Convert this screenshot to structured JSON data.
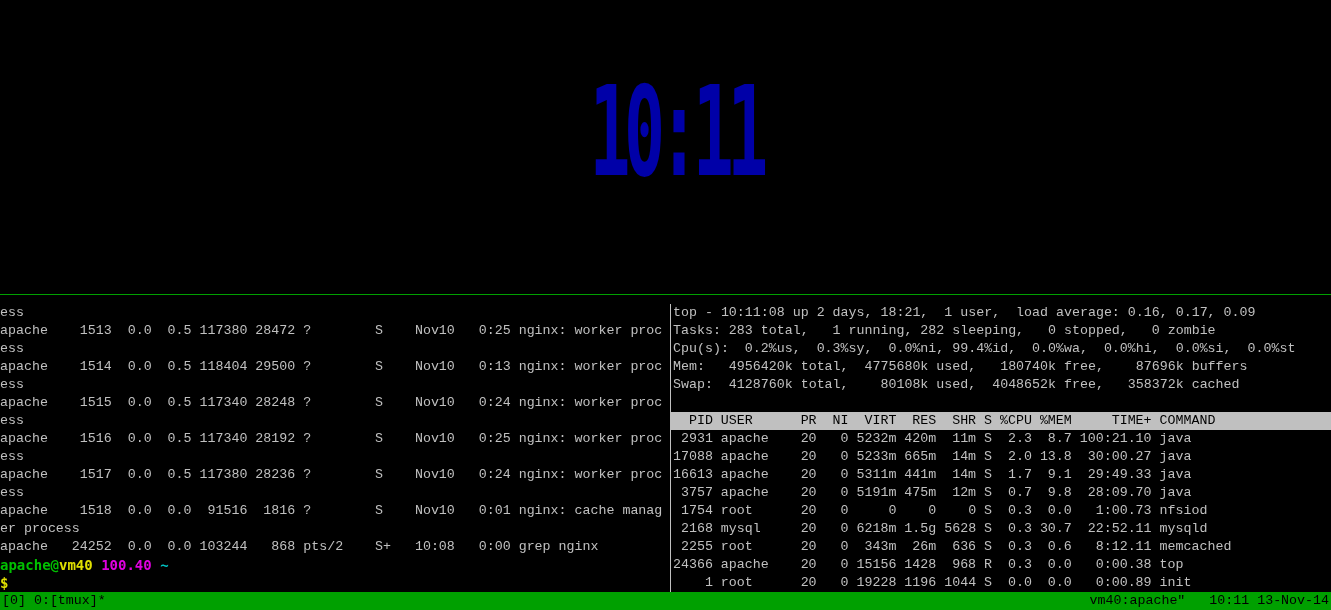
{
  "clock_pane": {
    "time": "10:11"
  },
  "left_pane": {
    "lines": [
      {
        "kind": "text",
        "text": "ess"
      },
      {
        "kind": "text",
        "text": "apache    1513  0.0  0.5 117380 28472 ?        S    Nov10   0:25 nginx: worker proc"
      },
      {
        "kind": "text",
        "text": "ess"
      },
      {
        "kind": "text",
        "text": "apache    1514  0.0  0.5 118404 29500 ?        S    Nov10   0:13 nginx: worker proc"
      },
      {
        "kind": "text",
        "text": "ess"
      },
      {
        "kind": "text",
        "text": "apache    1515  0.0  0.5 117340 28248 ?        S    Nov10   0:24 nginx: worker proc"
      },
      {
        "kind": "text",
        "text": "ess"
      },
      {
        "kind": "text",
        "text": "apache    1516  0.0  0.5 117340 28192 ?        S    Nov10   0:25 nginx: worker proc"
      },
      {
        "kind": "text",
        "text": "ess"
      },
      {
        "kind": "text",
        "text": "apache    1517  0.0  0.5 117380 28236 ?        S    Nov10   0:24 nginx: worker proc"
      },
      {
        "kind": "text",
        "text": "ess"
      },
      {
        "kind": "text",
        "text": "apache    1518  0.0  0.0  91516  1816 ?        S    Nov10   0:01 nginx: cache manag"
      },
      {
        "kind": "text",
        "text": "er process"
      },
      {
        "kind": "text",
        "text": "apache   24252  0.0  0.0 103244   868 pts/2    S+   10:08   0:00 grep nginx"
      },
      {
        "kind": "prompt",
        "segments": [
          {
            "text": "apache@",
            "color": "#00c000"
          },
          {
            "text": "vm40",
            "color": "#e0e000"
          },
          {
            "text": "100.40",
            "color": "#e000e0"
          },
          {
            "text": "~",
            "color": "#00c0c0"
          }
        ]
      },
      {
        "kind": "prompt",
        "segments": [
          {
            "text": "$",
            "color": "#e0e000"
          }
        ]
      }
    ]
  },
  "top_pane": {
    "summary": [
      "top - 10:11:08 up 2 days, 18:21,  1 user,  load average: 0.16, 0.17, 0.09",
      "Tasks: 283 total,   1 running, 282 sleeping,   0 stopped,   0 zombie",
      "Cpu(s):  0.2%us,  0.3%sy,  0.0%ni, 99.4%id,  0.0%wa,  0.0%hi,  0.0%si,  0.0%st",
      "Mem:   4956420k total,  4775680k used,   180740k free,    87696k buffers",
      "Swap:  4128760k total,    80108k used,  4048652k free,   358372k cached"
    ],
    "columns": [
      "PID",
      "USER",
      "PR",
      "NI",
      "VIRT",
      "RES",
      "SHR",
      "S",
      "%CPU",
      "%MEM",
      "TIME+",
      "COMMAND"
    ],
    "rows": [
      [
        "2931",
        "apache",
        "20",
        "0",
        "5232m",
        "420m",
        "11m",
        "S",
        "2.3",
        "8.7",
        "100:21.10",
        "java"
      ],
      [
        "17088",
        "apache",
        "20",
        "0",
        "5233m",
        "665m",
        "14m",
        "S",
        "2.0",
        "13.8",
        "30:00.27",
        "java"
      ],
      [
        "16613",
        "apache",
        "20",
        "0",
        "5311m",
        "441m",
        "14m",
        "S",
        "1.7",
        "9.1",
        "29:49.33",
        "java"
      ],
      [
        "3757",
        "apache",
        "20",
        "0",
        "5191m",
        "475m",
        "12m",
        "S",
        "0.7",
        "9.8",
        "28:09.70",
        "java"
      ],
      [
        "1754",
        "root",
        "20",
        "0",
        "0",
        "0",
        "0",
        "S",
        "0.3",
        "0.0",
        "1:00.73",
        "nfsiod"
      ],
      [
        "2168",
        "mysql",
        "20",
        "0",
        "6218m",
        "1.5g",
        "5628",
        "S",
        "0.3",
        "30.7",
        "22:52.11",
        "mysqld"
      ],
      [
        "2255",
        "root",
        "20",
        "0",
        "343m",
        "26m",
        "636",
        "S",
        "0.3",
        "0.6",
        "8:12.11",
        "memcached"
      ],
      [
        "24366",
        "apache",
        "20",
        "0",
        "15156",
        "1428",
        "968",
        "R",
        "0.3",
        "0.0",
        "0:00.38",
        "top"
      ],
      [
        "1",
        "root",
        "20",
        "0",
        "19228",
        "1196",
        "1044",
        "S",
        "0.0",
        "0.0",
        "0:00.89",
        "init"
      ]
    ]
  },
  "status_bar": {
    "windows": "[0] 0:[tmux]*",
    "host": "vm40:apache\"",
    "datetime": "10:11 13-Nov-14"
  }
}
